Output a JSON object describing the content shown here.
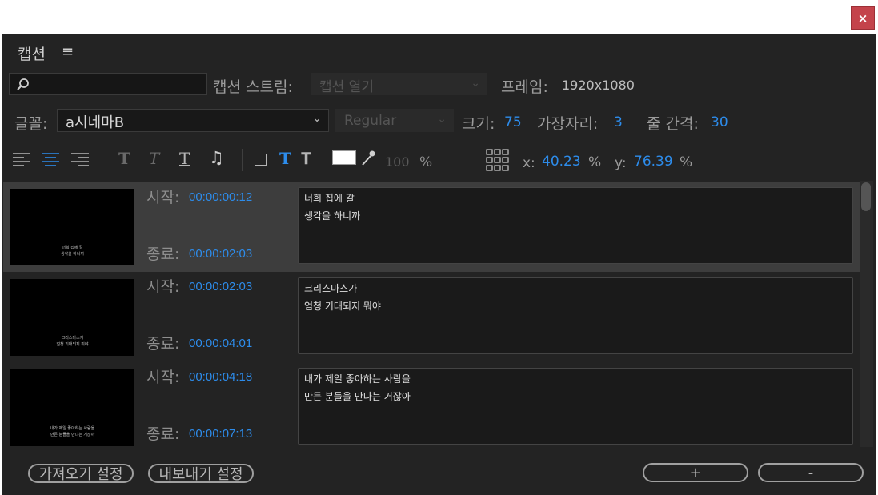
{
  "window": {
    "close_label": "×"
  },
  "panel": {
    "title": "캡션",
    "menu_icon": "≡"
  },
  "search": {
    "placeholder": ""
  },
  "stream": {
    "label": "캡션 스트림:",
    "value": "캡션 열기",
    "frame_label": "프레임:",
    "frame_value": "1920x1080"
  },
  "font": {
    "label": "글꼴:",
    "family": "a시네마B",
    "style": "Regular",
    "size_label": "크기:",
    "size": "75",
    "edge_label": "가장자리:",
    "edge": "3",
    "spacing_label": "줄 간격:",
    "spacing": "30"
  },
  "toolbar": {
    "opacity": "100",
    "percent": "%",
    "x_label": "x:",
    "x_value": "40.23",
    "y_label": "y:",
    "y_value": "76.39",
    "text_color": "#ffffff"
  },
  "captions": [
    {
      "start_label": "시작:",
      "start": "00:00:00:12",
      "end_label": "종료:",
      "end": "00:00:02:03",
      "line1": "너희 집에 갈",
      "line2": "생각을 하니까",
      "selected": true
    },
    {
      "start_label": "시작:",
      "start": "00:00:02:03",
      "end_label": "종료:",
      "end": "00:00:04:01",
      "line1": "크리스마스가",
      "line2": "엄청 기대되지 뭐야",
      "selected": false
    },
    {
      "start_label": "시작:",
      "start": "00:00:04:18",
      "end_label": "종료:",
      "end": "00:00:07:13",
      "line1": "내가 제일 좋아하는 사람을",
      "line2": "만든 분들을 만나는 거잖아",
      "selected": false
    }
  ],
  "footer": {
    "import_label": "가져오기 설정",
    "export_label": "내보내기 설정",
    "add_label": "+",
    "remove_label": "-"
  },
  "colors": {
    "accent": "#2d8ceb",
    "close": "#c4434b",
    "panel_bg": "#232323"
  }
}
